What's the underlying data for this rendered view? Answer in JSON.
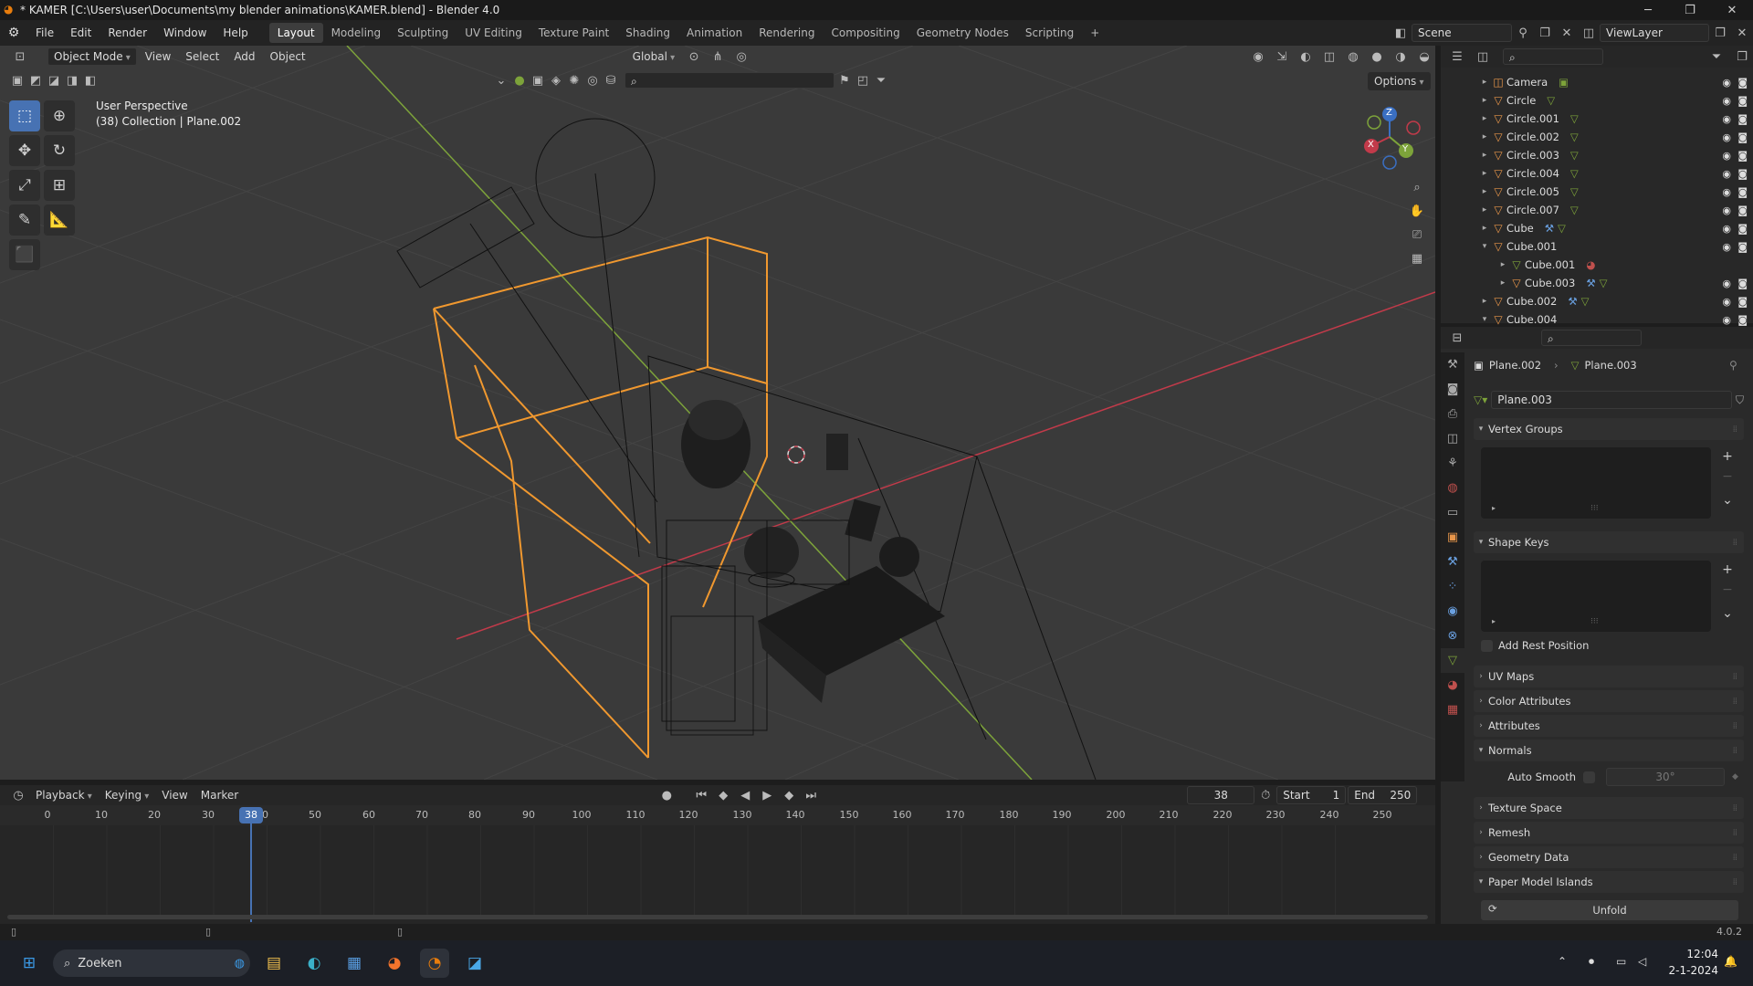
{
  "window": {
    "title": "* KAMER [C:\\Users\\user\\Documents\\my blender animations\\KAMER.blend] - Blender 4.0"
  },
  "menus": [
    "File",
    "Edit",
    "Render",
    "Window",
    "Help"
  ],
  "workspaces": [
    "Layout",
    "Modeling",
    "Sculpting",
    "UV Editing",
    "Texture Paint",
    "Shading",
    "Animation",
    "Rendering",
    "Compositing",
    "Geometry Nodes",
    "Scripting"
  ],
  "scene": {
    "name": "Scene",
    "view_layer": "ViewLayer"
  },
  "viewport_header": {
    "mode": "Object Mode",
    "menus": [
      "View",
      "Select",
      "Add",
      "Object"
    ],
    "orientation": "Global",
    "options": "Options"
  },
  "viewport": {
    "perspective": "User Perspective",
    "collection_info": "(38) Collection | Plane.002"
  },
  "gizmo": {
    "x": "X",
    "y": "Y",
    "z": "Z"
  },
  "outliner": {
    "items": [
      {
        "name": "Camera",
        "arrow": "▸",
        "indent": 0
      },
      {
        "name": "Circle",
        "arrow": "▸",
        "indent": 0
      },
      {
        "name": "Circle.001",
        "arrow": "▸",
        "indent": 0
      },
      {
        "name": "Circle.002",
        "arrow": "▸",
        "indent": 0
      },
      {
        "name": "Circle.003",
        "arrow": "▸",
        "indent": 0
      },
      {
        "name": "Circle.004",
        "arrow": "▸",
        "indent": 0
      },
      {
        "name": "Circle.005",
        "arrow": "▸",
        "indent": 0
      },
      {
        "name": "Circle.007",
        "arrow": "▸",
        "indent": 0
      },
      {
        "name": "Cube",
        "arrow": "▸",
        "indent": 0
      },
      {
        "name": "Cube.001",
        "arrow": "▾",
        "indent": 0
      },
      {
        "name": "Cube.001",
        "arrow": "▸",
        "indent": 1
      },
      {
        "name": "Cube.003",
        "arrow": "▸",
        "indent": 1
      },
      {
        "name": "Cube.002",
        "arrow": "▸",
        "indent": 0
      },
      {
        "name": "Cube.004",
        "arrow": "▾",
        "indent": 0
      }
    ]
  },
  "properties": {
    "breadcrumb_object": "Plane.002",
    "breadcrumb_mesh": "Plane.003",
    "mesh_name": "Plane.003",
    "panels": {
      "vertex_groups": "Vertex Groups",
      "shape_keys": "Shape Keys",
      "add_rest_position": "Add Rest Position",
      "uv_maps": "UV Maps",
      "color_attributes": "Color Attributes",
      "attributes": "Attributes",
      "normals": "Normals",
      "auto_smooth": "Auto Smooth",
      "auto_smooth_angle": "30°",
      "texture_space": "Texture Space",
      "remesh": "Remesh",
      "geometry_data": "Geometry Data",
      "paper_model_islands": "Paper Model Islands",
      "unfold": "Unfold"
    }
  },
  "timeline": {
    "menus": [
      "Playback",
      "Keying",
      "View",
      "Marker"
    ],
    "current_frame": "38",
    "start_label": "Start",
    "start": "1",
    "end_label": "End",
    "end": "250",
    "ticks": [
      "0",
      "10",
      "20",
      "30",
      "40",
      "50",
      "60",
      "70",
      "80",
      "90",
      "100",
      "110",
      "120",
      "130",
      "140",
      "150",
      "160",
      "170",
      "180",
      "190",
      "200",
      "210",
      "220",
      "230",
      "240",
      "250"
    ]
  },
  "statusbar": {
    "version": "4.0.2"
  },
  "taskbar": {
    "search": "Zoeken",
    "time": "12:04",
    "date": "2-1-2024"
  },
  "colors": {
    "accent": "#4772b3",
    "selection_orange": "#f0982f",
    "x_axis": "#c23a4a",
    "y_axis": "#7da33a",
    "z_axis": "#3a6fc2"
  }
}
